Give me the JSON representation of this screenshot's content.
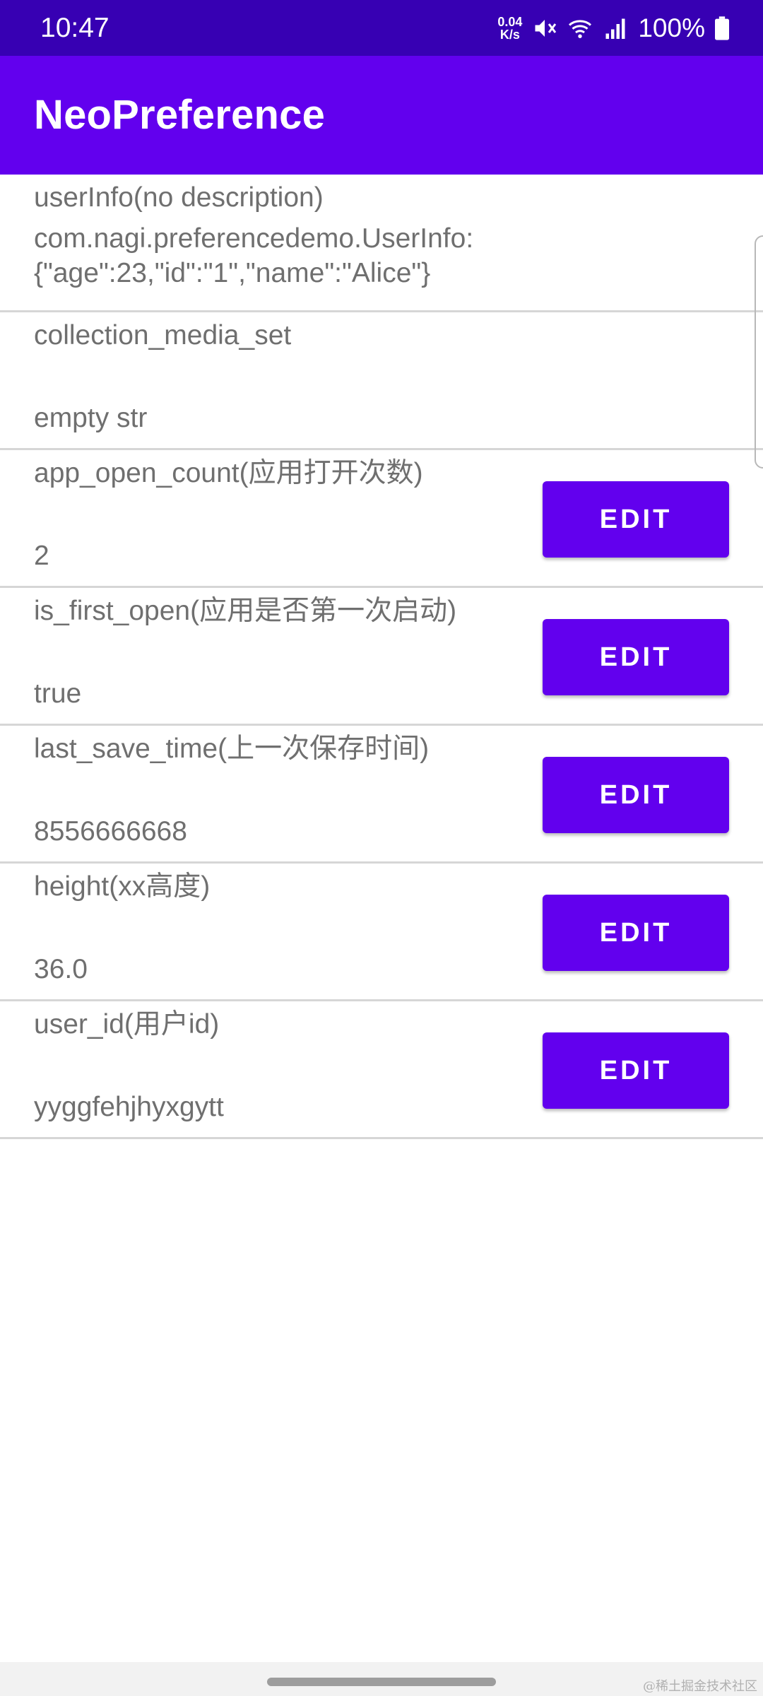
{
  "status_bar": {
    "time": "10:47",
    "net_speed_value": "0.04",
    "net_speed_unit": "K/s",
    "battery": "100%",
    "icons": [
      "mute-icon",
      "wifi-icon",
      "signal-icon",
      "battery-icon"
    ]
  },
  "app_bar": {
    "title": "NeoPreference"
  },
  "colors": {
    "primary": "#6200ee",
    "primary_dark": "#3700b3",
    "text_secondary": "#6f6f6f"
  },
  "preferences": [
    {
      "title": "userInfo(no description)",
      "value": "com.nagi.preferencedemo.UserInfo:\n{\"age\":23,\"id\":\"1\",\"name\":\"Alice\"}",
      "editable": false
    },
    {
      "title": "collection_media_set",
      "value": "empty str",
      "editable": false
    },
    {
      "title": "app_open_count(应用打开次数)",
      "value": "2",
      "editable": true
    },
    {
      "title": "is_first_open(应用是否第一次启动)",
      "value": "true",
      "editable": true
    },
    {
      "title": "last_save_time(上一次保存时间)",
      "value": "8556666668",
      "editable": true
    },
    {
      "title": "height(xx高度)",
      "value": "36.0",
      "editable": true
    },
    {
      "title": "user_id(用户id)",
      "value": "yyggfehjhyxgytt",
      "editable": true
    }
  ],
  "edit_label": "EDIT",
  "watermark": "@稀土掘金技术社区"
}
